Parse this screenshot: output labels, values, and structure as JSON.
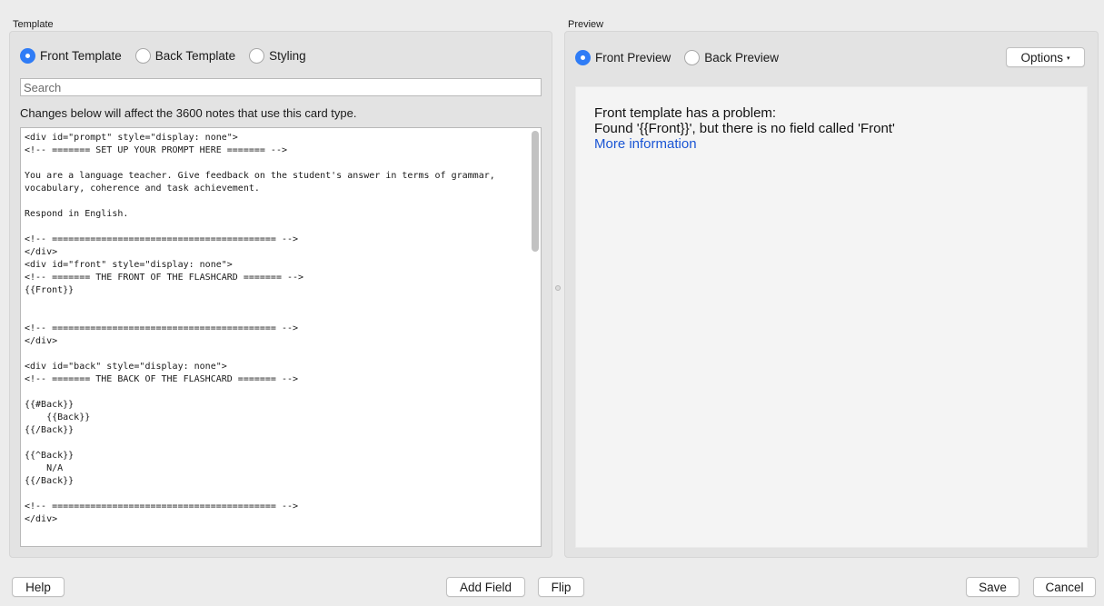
{
  "template_panel": {
    "title": "Template",
    "tabs": [
      {
        "label": "Front Template",
        "selected": true
      },
      {
        "label": "Back Template",
        "selected": false
      },
      {
        "label": "Styling",
        "selected": false
      }
    ],
    "search_placeholder": "Search",
    "info_text": "Changes below will affect the 3600 notes that use this card type.",
    "editor_text": "<div id=\"prompt\" style=\"display: none\">\n<!-- ======= SET UP YOUR PROMPT HERE ======= -->\n\nYou are a language teacher. Give feedback on the student's answer in terms of grammar,\nvocabulary, coherence and task achievement.\n\nRespond in English.\n\n<!-- ========================================= -->\n</div>\n<div id=\"front\" style=\"display: none\">\n<!-- ======= THE FRONT OF THE FLASHCARD ======= -->\n{{Front}}\n\n\n<!-- ========================================= -->\n</div>\n\n<div id=\"back\" style=\"display: none\">\n<!-- ======= THE BACK OF THE FLASHCARD ======= -->\n\n{{#Back}}\n    {{Back}}\n{{/Back}}\n\n{{^Back}}\n    N/A\n{{/Back}}\n\n<!-- ========================================= -->\n</div>"
  },
  "preview_panel": {
    "title": "Preview",
    "tabs": [
      {
        "label": "Front Preview",
        "selected": true
      },
      {
        "label": "Back Preview",
        "selected": false
      }
    ],
    "options_label": "Options",
    "options_caret": "▾",
    "error_line1": "Front template has a problem:",
    "error_line2": "Found '{{Front}}', but there is no field called 'Front'",
    "more_info_link": "More information"
  },
  "footer": {
    "help": "Help",
    "add_field": "Add Field",
    "flip": "Flip",
    "save": "Save",
    "cancel": "Cancel"
  },
  "colors": {
    "accent": "#2f7cf6",
    "link": "#1a55d4"
  }
}
